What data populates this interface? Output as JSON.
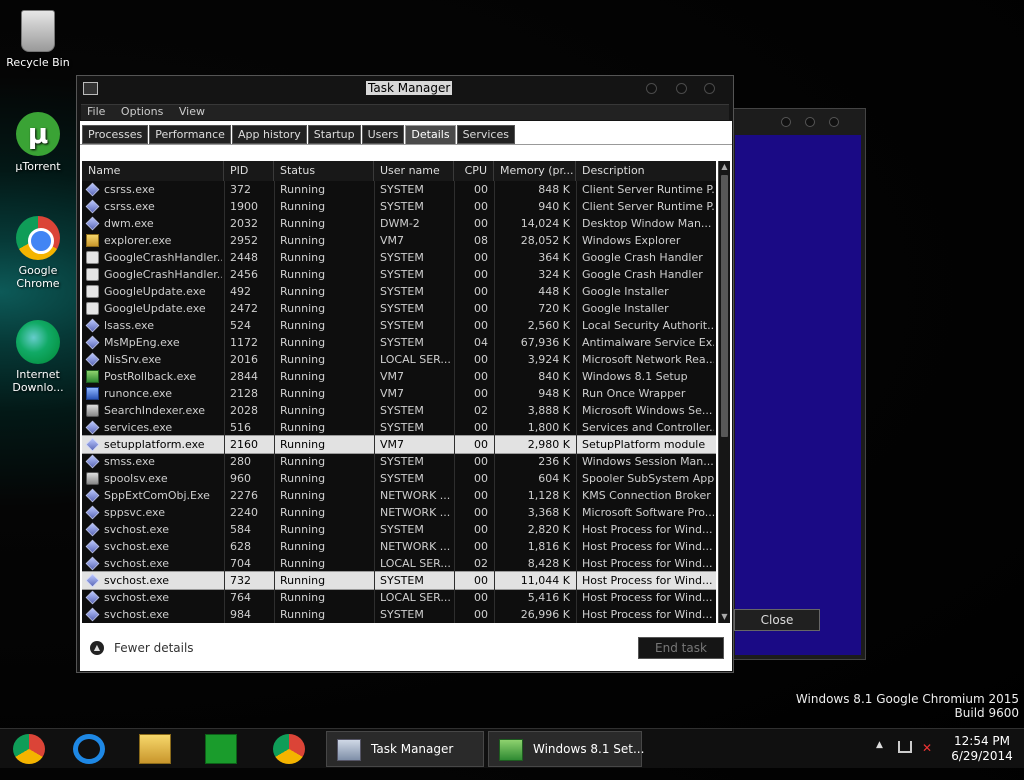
{
  "desktop": {
    "icons": [
      {
        "label": "Recycle Bin"
      },
      {
        "label": "µTorrent",
        "glyph": "µ"
      },
      {
        "label": "Google Chrome"
      },
      {
        "label": "Internet Downlo..."
      }
    ],
    "watermark": {
      "line1": "Windows 8.1 Google Chromium 2015",
      "line2": "Build 9600"
    }
  },
  "background_dialog": {
    "close_label": "Close",
    "accent": "#1a0a85"
  },
  "task_manager": {
    "title": "Task Manager",
    "menu": [
      "File",
      "Options",
      "View"
    ],
    "tabs": [
      "Processes",
      "Performance",
      "App history",
      "Startup",
      "Users",
      "Details",
      "Services"
    ],
    "active_tab": "Details",
    "columns": [
      "Name",
      "PID",
      "Status",
      "User name",
      "CPU",
      "Memory (pr...",
      "Description"
    ],
    "rows": [
      {
        "icon": "diamond",
        "name": "csrss.exe",
        "pid": "372",
        "status": "Running",
        "user": "SYSTEM",
        "cpu": "00",
        "mem": "848 K",
        "desc": "Client Server Runtime P..."
      },
      {
        "icon": "diamond",
        "name": "csrss.exe",
        "pid": "1900",
        "status": "Running",
        "user": "SYSTEM",
        "cpu": "00",
        "mem": "940 K",
        "desc": "Client Server Runtime P..."
      },
      {
        "icon": "diamond",
        "name": "dwm.exe",
        "pid": "2032",
        "status": "Running",
        "user": "DWM-2",
        "cpu": "00",
        "mem": "14,024 K",
        "desc": "Desktop Window Man..."
      },
      {
        "icon": "folder",
        "name": "explorer.exe",
        "pid": "2952",
        "status": "Running",
        "user": "VM7",
        "cpu": "08",
        "mem": "28,052 K",
        "desc": "Windows Explorer"
      },
      {
        "icon": "google",
        "name": "GoogleCrashHandler....",
        "pid": "2448",
        "status": "Running",
        "user": "SYSTEM",
        "cpu": "00",
        "mem": "364 K",
        "desc": "Google Crash Handler"
      },
      {
        "icon": "google",
        "name": "GoogleCrashHandler....",
        "pid": "2456",
        "status": "Running",
        "user": "SYSTEM",
        "cpu": "00",
        "mem": "324 K",
        "desc": "Google Crash Handler"
      },
      {
        "icon": "google",
        "name": "GoogleUpdate.exe",
        "pid": "492",
        "status": "Running",
        "user": "SYSTEM",
        "cpu": "00",
        "mem": "448 K",
        "desc": "Google Installer"
      },
      {
        "icon": "google",
        "name": "GoogleUpdate.exe",
        "pid": "2472",
        "status": "Running",
        "user": "SYSTEM",
        "cpu": "00",
        "mem": "720 K",
        "desc": "Google Installer"
      },
      {
        "icon": "diamond",
        "name": "lsass.exe",
        "pid": "524",
        "status": "Running",
        "user": "SYSTEM",
        "cpu": "00",
        "mem": "2,560 K",
        "desc": "Local Security Authorit..."
      },
      {
        "icon": "diamond",
        "name": "MsMpEng.exe",
        "pid": "1172",
        "status": "Running",
        "user": "SYSTEM",
        "cpu": "04",
        "mem": "67,936 K",
        "desc": "Antimalware Service Ex..."
      },
      {
        "icon": "diamond",
        "name": "NisSrv.exe",
        "pid": "2016",
        "status": "Running",
        "user": "LOCAL SER...",
        "cpu": "00",
        "mem": "3,924 K",
        "desc": "Microsoft Network Rea..."
      },
      {
        "icon": "green",
        "name": "PostRollback.exe",
        "pid": "2844",
        "status": "Running",
        "user": "VM7",
        "cpu": "00",
        "mem": "840 K",
        "desc": "Windows 8.1 Setup"
      },
      {
        "icon": "blue",
        "name": "runonce.exe",
        "pid": "2128",
        "status": "Running",
        "user": "VM7",
        "cpu": "00",
        "mem": "948 K",
        "desc": "Run Once Wrapper"
      },
      {
        "icon": "gray",
        "name": "SearchIndexer.exe",
        "pid": "2028",
        "status": "Running",
        "user": "SYSTEM",
        "cpu": "02",
        "mem": "3,888 K",
        "desc": "Microsoft Windows Se..."
      },
      {
        "icon": "diamond",
        "name": "services.exe",
        "pid": "516",
        "status": "Running",
        "user": "SYSTEM",
        "cpu": "00",
        "mem": "1,800 K",
        "desc": "Services and Controller..."
      },
      {
        "icon": "diamond",
        "name": "setupplatform.exe",
        "pid": "2160",
        "status": "Running",
        "user": "VM7",
        "cpu": "00",
        "mem": "2,980 K",
        "desc": "SetupPlatform module",
        "selected": true
      },
      {
        "icon": "diamond",
        "name": "smss.exe",
        "pid": "280",
        "status": "Running",
        "user": "SYSTEM",
        "cpu": "00",
        "mem": "236 K",
        "desc": "Windows Session Man..."
      },
      {
        "icon": "gray",
        "name": "spoolsv.exe",
        "pid": "960",
        "status": "Running",
        "user": "SYSTEM",
        "cpu": "00",
        "mem": "604 K",
        "desc": "Spooler SubSystem App"
      },
      {
        "icon": "diamond",
        "name": "SppExtComObj.Exe",
        "pid": "2276",
        "status": "Running",
        "user": "NETWORK ...",
        "cpu": "00",
        "mem": "1,128 K",
        "desc": "KMS Connection Broker"
      },
      {
        "icon": "diamond",
        "name": "sppsvc.exe",
        "pid": "2240",
        "status": "Running",
        "user": "NETWORK ...",
        "cpu": "00",
        "mem": "3,368 K",
        "desc": "Microsoft Software Pro..."
      },
      {
        "icon": "diamond",
        "name": "svchost.exe",
        "pid": "584",
        "status": "Running",
        "user": "SYSTEM",
        "cpu": "00",
        "mem": "2,820 K",
        "desc": "Host Process for Wind..."
      },
      {
        "icon": "diamond",
        "name": "svchost.exe",
        "pid": "628",
        "status": "Running",
        "user": "NETWORK ...",
        "cpu": "00",
        "mem": "1,816 K",
        "desc": "Host Process for Wind..."
      },
      {
        "icon": "diamond",
        "name": "svchost.exe",
        "pid": "704",
        "status": "Running",
        "user": "LOCAL SER...",
        "cpu": "02",
        "mem": "8,428 K",
        "desc": "Host Process for Wind..."
      },
      {
        "icon": "diamond",
        "name": "svchost.exe",
        "pid": "732",
        "status": "Running",
        "user": "SYSTEM",
        "cpu": "00",
        "mem": "11,044 K",
        "desc": "Host Process for Wind...",
        "selected": true
      },
      {
        "icon": "diamond",
        "name": "svchost.exe",
        "pid": "764",
        "status": "Running",
        "user": "LOCAL SER...",
        "cpu": "00",
        "mem": "5,416 K",
        "desc": "Host Process for Wind..."
      },
      {
        "icon": "diamond",
        "name": "svchost.exe",
        "pid": "984",
        "status": "Running",
        "user": "SYSTEM",
        "cpu": "00",
        "mem": "26,996 K",
        "desc": "Host Process for Wind..."
      }
    ],
    "fewer_details": "Fewer details",
    "end_task": "End task"
  },
  "taskbar": {
    "pinned": [
      "chrome-icon",
      "internet-explorer-icon",
      "file-explorer-icon",
      "store-icon",
      "chrome-icon"
    ],
    "buttons": [
      {
        "label": "Task Manager",
        "icon": "task-manager-icon"
      },
      {
        "label": "Windows 8.1 Set...",
        "icon": "setup-icon"
      }
    ],
    "tray": {
      "chevron": "▲",
      "network": "network-icon",
      "volume": "volume-muted-icon"
    },
    "clock": {
      "time": "12:54 PM",
      "date": "6/29/2014"
    }
  }
}
